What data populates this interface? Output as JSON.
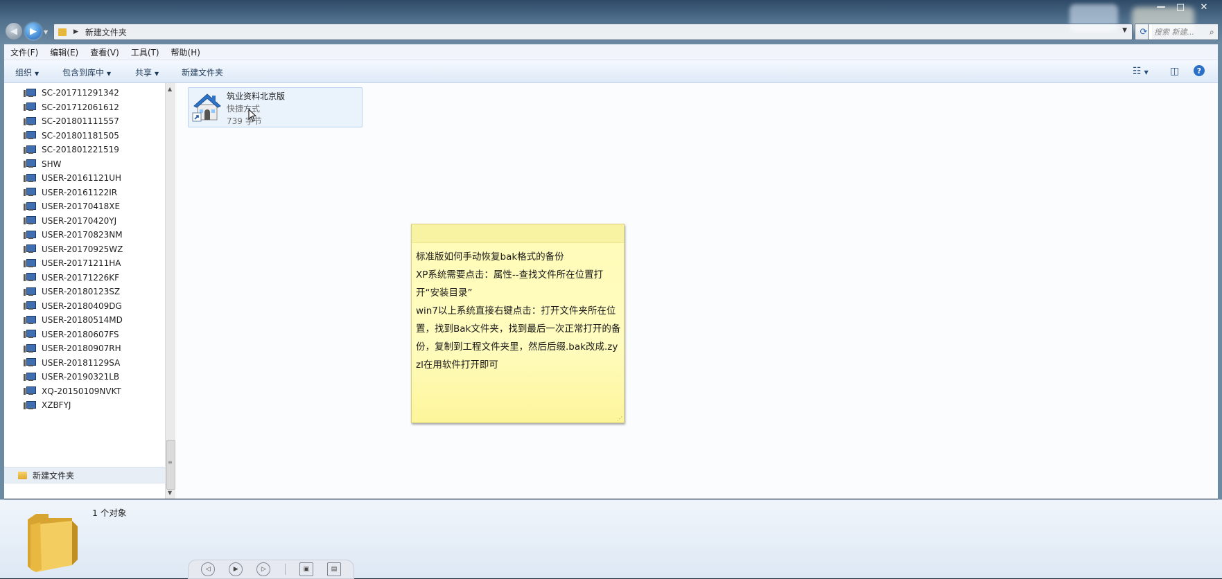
{
  "window": {
    "caption_buttons": [
      "—",
      "□",
      "✕"
    ]
  },
  "address_bar": {
    "path": "新建文件夹",
    "search_placeholder": "搜索 新建..."
  },
  "menu": [
    "文件(F)",
    "编辑(E)",
    "查看(V)",
    "工具(T)",
    "帮助(H)"
  ],
  "toolbar": {
    "organize": "组织",
    "include_in_library": "包含到库中",
    "share": "共享",
    "new_folder": "新建文件夹"
  },
  "nav_pane": {
    "computers": [
      "SC-201711291342",
      "SC-201712061612",
      "SC-201801111557",
      "SC-201801181505",
      "SC-201801221519",
      "SHW",
      "USER-20161121UH",
      "USER-20161122IR",
      "USER-20170418XE",
      "USER-20170420YJ",
      "USER-20170823NM",
      "USER-20170925WZ",
      "USER-20171211HA",
      "USER-20171226KF",
      "USER-20180123SZ",
      "USER-20180409DG",
      "USER-20180514MD",
      "USER-20180607FS",
      "USER-20180907RH",
      "USER-20181129SA",
      "USER-20190321LB",
      "XQ-20150109NVKT",
      "XZBFYJ"
    ],
    "selected_folder": "新建文件夹"
  },
  "file": {
    "name": "筑业资料北京版",
    "type": "快捷方式",
    "size": "739 字节"
  },
  "sticky_note": {
    "lines": [
      "标准版如何手动恢复bak格式的备份",
      "XP系统需要点击：属性--查找文件所在位置打开“安装目录”",
      "win7以上系统直接右键点击：打开文件夹所在位置，找到Bak文件夹，找到最后一次正常打开的备份，复制到工程文件夹里，然后后缀.bak改成.zyzl在用软件打开即可"
    ]
  },
  "details": {
    "count": "1 个对象"
  },
  "colors": {
    "note_bg": "#fffcbf",
    "selection": "#eaf3fc",
    "title_gradient": "#4f6f8c"
  }
}
